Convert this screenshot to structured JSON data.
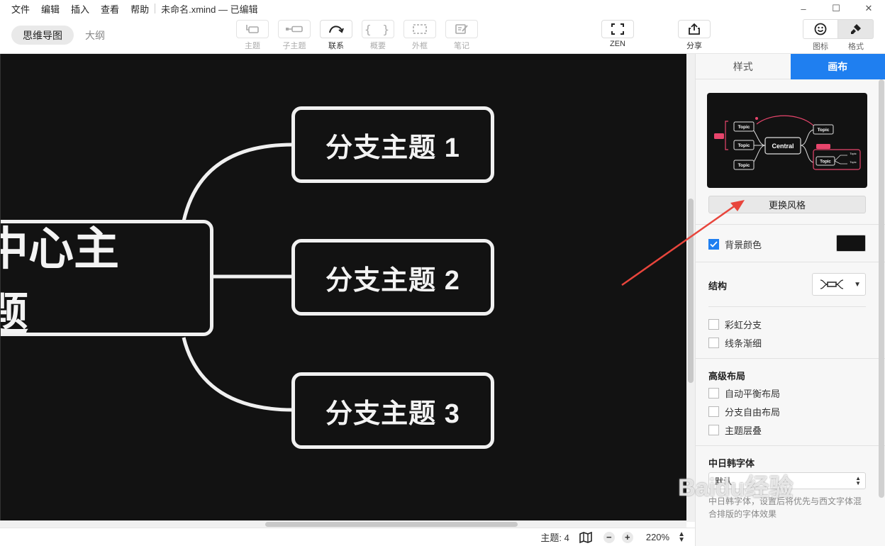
{
  "menubar": {
    "items": [
      "文件",
      "编辑",
      "插入",
      "查看",
      "帮助"
    ],
    "document_title": "未命名.xmind — 已编辑"
  },
  "window_controls": {
    "minimize": "–",
    "maximize": "☐",
    "close": "✕"
  },
  "toolbar": {
    "view_tabs": [
      "思维导图",
      "大纲"
    ],
    "tools": {
      "topic": "主题",
      "subtopic": "子主题",
      "relationship": "联系",
      "summary": "概要",
      "boundary": "外框",
      "note": "笔记",
      "zen": "ZEN",
      "share": "分享"
    },
    "right": {
      "icon": "图标",
      "format": "格式"
    }
  },
  "canvas": {
    "central_topic": "中心主题",
    "branches": [
      "分支主题 1",
      "分支主题 2",
      "分支主题 3"
    ],
    "colors": {
      "background": "#121212",
      "stroke": "#f0f0f0"
    }
  },
  "statusbar": {
    "topic_count": "主题: 4",
    "zoom_out": "−",
    "zoom_in": "+",
    "zoom_level": "220%"
  },
  "panel": {
    "tabs": [
      "样式",
      "画布"
    ],
    "active_tab": "画布",
    "thumbnail": {
      "central": "Central",
      "topics": [
        "Topic",
        "Topic",
        "Topic",
        "Topic",
        "Topic"
      ],
      "subtopics": [
        "Topic",
        "Topic"
      ]
    },
    "change_style_button": "更换风格",
    "background_color": {
      "label": "背景颜色",
      "checked": true,
      "value": "#121212"
    },
    "structure_label": "结构",
    "options_a": [
      {
        "label": "彩虹分支",
        "checked": false
      },
      {
        "label": "线条渐细",
        "checked": false
      }
    ],
    "advanced_layout": "高级布局",
    "options_b": [
      {
        "label": "自动平衡布局",
        "checked": false
      },
      {
        "label": "分支自由布局",
        "checked": false
      },
      {
        "label": "主题层叠",
        "checked": false
      }
    ],
    "cjk_font": {
      "label": "中日韩字体",
      "value": "默认",
      "description": "中日韩字体，设置后将优先与西文字体混合排版的字体效果"
    }
  },
  "accent_color": "#1f7ff0",
  "annotation_color": "#e8453c",
  "watermark": "Baidu经验 jingyan.baidu.com"
}
